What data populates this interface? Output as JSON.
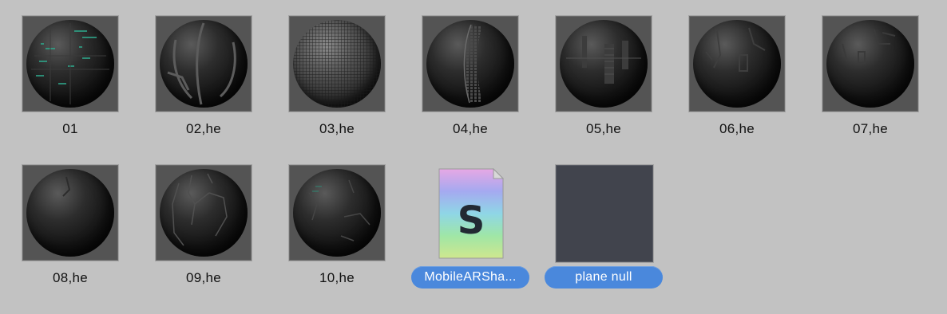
{
  "items": [
    {
      "name": "01",
      "pattern": "circuit-teal"
    },
    {
      "name": "02,he",
      "pattern": "panel-lines"
    },
    {
      "name": "03,he",
      "pattern": "fine-grid"
    },
    {
      "name": "04,he",
      "pattern": "vertical-stripes"
    },
    {
      "name": "05,he",
      "pattern": "tech-panels"
    },
    {
      "name": "06,he",
      "pattern": "tech-dark"
    },
    {
      "name": "07,he",
      "pattern": "tech-faint"
    },
    {
      "name": "08,he",
      "pattern": "plain-dark"
    },
    {
      "name": "09,he",
      "pattern": "panel-cracks"
    },
    {
      "name": "10,he",
      "pattern": "circuit-panels"
    },
    {
      "name": "MobileARSha...",
      "type": "shader-file",
      "icon_letter": "S",
      "selected": true
    },
    {
      "name": "plane null",
      "type": "flat-material",
      "selected": true
    }
  ],
  "colors": {
    "background": "#c2c2c2",
    "selection": "#4a88dc",
    "thumb_bg": "#545454",
    "plane_swatch": "#41444d"
  }
}
